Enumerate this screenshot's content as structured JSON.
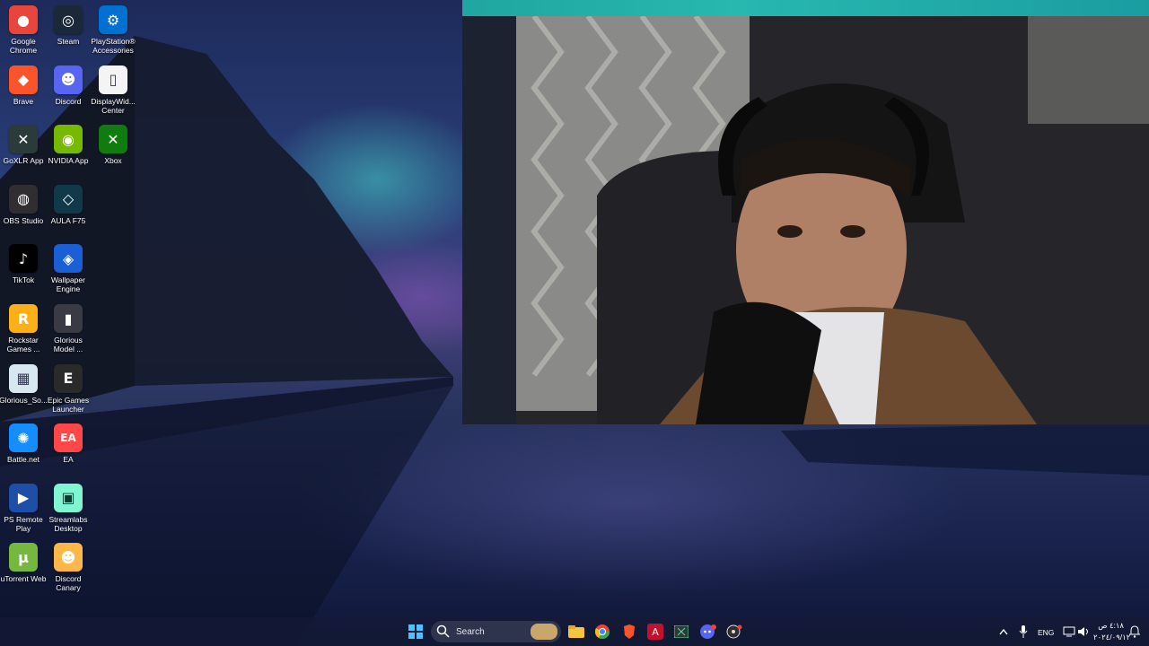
{
  "desktop": {
    "icons": [
      {
        "label": "Google Chrome",
        "icon": "chrome-icon",
        "color": "#e8453c"
      },
      {
        "label": "Steam",
        "icon": "steam-icon",
        "color": "#1b2838"
      },
      {
        "label": "PlayStation® Accessories",
        "icon": "playstation-accessories-icon",
        "color": "#0070d1"
      },
      {
        "label": "Brave",
        "icon": "brave-icon",
        "color": "#fb542b"
      },
      {
        "label": "Discord",
        "icon": "discord-icon",
        "color": "#5865f2"
      },
      {
        "label": "DisplayWid... Center",
        "icon": "document-icon",
        "color": "#f4f4f4"
      },
      {
        "label": "GoXLR App",
        "icon": "goxlr-icon",
        "color": "#2a3b3a"
      },
      {
        "label": "NVIDIA App",
        "icon": "nvidia-icon",
        "color": "#76b900"
      },
      {
        "label": "Xbox",
        "icon": "xbox-icon",
        "color": "#107c10"
      },
      {
        "label": "OBS Studio",
        "icon": "obs-icon",
        "color": "#302e31"
      },
      {
        "label": "AULA F75",
        "icon": "aula-icon",
        "color": "#103a4a"
      },
      {
        "label": "TikTok",
        "icon": "tiktok-icon",
        "color": "#010101"
      },
      {
        "label": "Wallpaper Engine",
        "icon": "wallpaper-engine-icon",
        "color": "#1a5fd6"
      },
      {
        "label": "Rockstar Games ...",
        "icon": "rockstar-icon",
        "color": "#fcaf17"
      },
      {
        "label": "Glorious Model ...",
        "icon": "glorious-mouse-icon",
        "color": "#3a3a44"
      },
      {
        "label": "Glorious_So...",
        "icon": "glorious-software-icon",
        "color": "#d8e8f0"
      },
      {
        "label": "Epic Games Launcher",
        "icon": "epic-games-icon",
        "color": "#2a2a2a"
      },
      {
        "label": "Battle.net",
        "icon": "battlenet-icon",
        "color": "#148eff"
      },
      {
        "label": "EA",
        "icon": "ea-icon",
        "color": "#ff4747"
      },
      {
        "label": "PS Remote Play",
        "icon": "ps-remote-play-icon",
        "color": "#1e4fa8"
      },
      {
        "label": "Streamlabs Desktop",
        "icon": "streamlabs-icon",
        "color": "#80f5d2"
      },
      {
        "label": "uTorrent Web",
        "icon": "utorrent-icon",
        "color": "#76b83f"
      },
      {
        "label": "Discord Canary",
        "icon": "discord-canary-icon",
        "color": "#fbb848"
      }
    ]
  },
  "webcam": {
    "description_color": "#1a1a1c"
  },
  "taskbar": {
    "search_label": "Search",
    "apps": [
      "start-icon",
      "file-explorer-icon",
      "chrome-icon",
      "brave-icon",
      "adobe-icon",
      "goxlr-icon",
      "discord-icon",
      "obs-icon"
    ],
    "tray": {
      "language": "ENG",
      "time": "٤:١٨ ص",
      "date": "٢٠٢٤/٠٩/١٢"
    }
  }
}
